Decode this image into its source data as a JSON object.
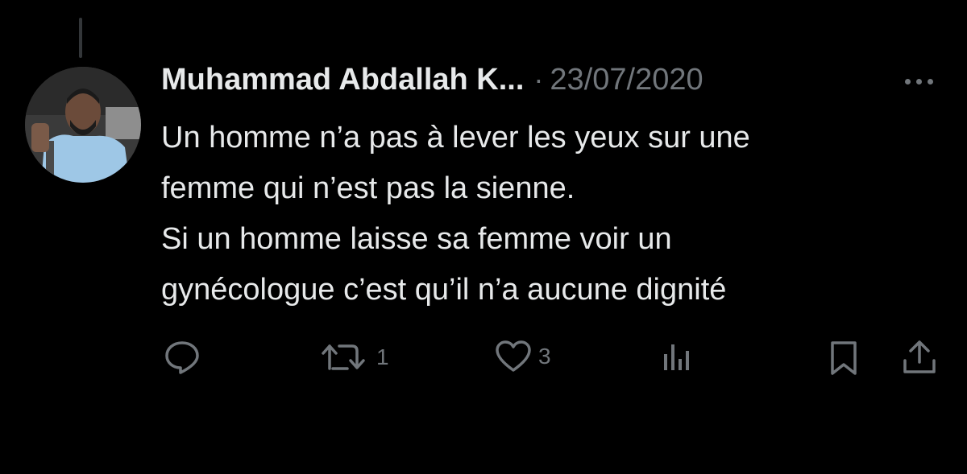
{
  "tweet": {
    "author": "Muhammad Abdallah K...",
    "separator": "·",
    "date": "23/07/2020",
    "lines": [
      "Un homme n’a pas à lever les yeux sur une",
      "femme qui n’est pas la sienne.",
      "Si un homme laisse sa femme voir un",
      "gynécologue c’est qu’il n’a aucune dignité"
    ]
  },
  "actions": {
    "reply": {
      "icon": "reply-icon"
    },
    "retweet": {
      "icon": "retweet-icon",
      "count": "1"
    },
    "like": {
      "icon": "heart-icon",
      "count": "3"
    },
    "views": {
      "icon": "views-icon"
    },
    "bookmark": {
      "icon": "bookmark-icon"
    },
    "share": {
      "icon": "share-icon"
    }
  },
  "colors": {
    "background": "#000000",
    "primary_text": "#e7e9ea",
    "secondary_text": "#71767b"
  }
}
